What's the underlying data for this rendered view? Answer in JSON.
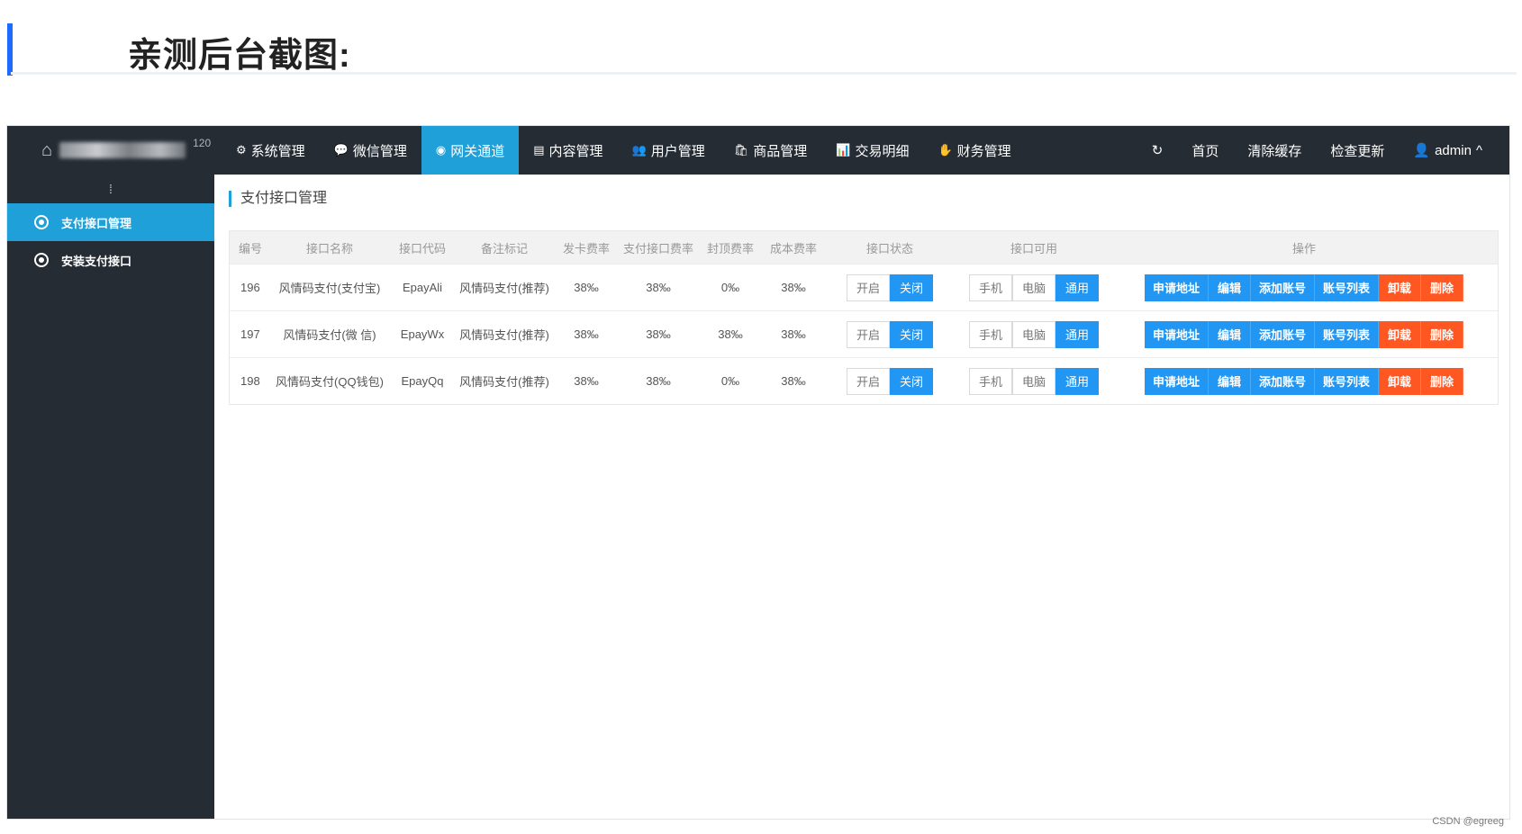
{
  "slide": {
    "title": "亲测后台截图:"
  },
  "topbar": {
    "brand_suffix": "120",
    "nav": [
      {
        "label": "系统管理",
        "icon": "gear-icon",
        "glyph": "⚙"
      },
      {
        "label": "微信管理",
        "icon": "wechat-icon",
        "glyph": "💬"
      },
      {
        "label": "网关通道",
        "icon": "gateway-icon",
        "glyph": "◉"
      },
      {
        "label": "内容管理",
        "icon": "document-icon",
        "glyph": "▤"
      },
      {
        "label": "用户管理",
        "icon": "users-icon",
        "glyph": "👥"
      },
      {
        "label": "商品管理",
        "icon": "shopping-bag-icon",
        "glyph": "🛍"
      },
      {
        "label": "交易明细",
        "icon": "chart-icon",
        "glyph": "📊"
      },
      {
        "label": "财务管理",
        "icon": "finance-icon",
        "glyph": "✋"
      }
    ],
    "refresh_glyph": "↻",
    "home": "首页",
    "clear_cache": "清除缓存",
    "check_update": "检查更新",
    "user": "admin",
    "user_glyph": "👤",
    "caret_glyph": "^"
  },
  "sidebar": {
    "toggle_glyph": "⁞",
    "items": [
      {
        "label": "支付接口管理"
      },
      {
        "label": "安装支付接口"
      }
    ]
  },
  "content": {
    "breadcrumb": "支付接口管理",
    "columns": [
      "编号",
      "接口名称",
      "接口代码",
      "备注标记",
      "发卡费率",
      "支付接口费率",
      "封顶费率",
      "成本费率",
      "接口状态",
      "接口可用",
      "操作"
    ],
    "status_labels": {
      "open": "开启",
      "close": "关闭"
    },
    "avail_labels": {
      "mobile": "手机",
      "pc": "电脑",
      "common": "通用"
    },
    "op_labels": {
      "apply_url": "申请地址",
      "edit": "编辑",
      "add_account": "添加账号",
      "account_list": "账号列表",
      "uninstall": "卸载",
      "delete": "删除"
    },
    "rows": [
      {
        "id": "196",
        "name": "风情码支付(支付宝)",
        "code": "EpayAli",
        "remark": "风情码支付(推荐)",
        "card_rate": "38‰",
        "pay_rate": "38‰",
        "cap_rate": "0‰",
        "cost_rate": "38‰"
      },
      {
        "id": "197",
        "name": "风情码支付(微 信)",
        "code": "EpayWx",
        "remark": "风情码支付(推荐)",
        "card_rate": "38‰",
        "pay_rate": "38‰",
        "cap_rate": "38‰",
        "cost_rate": "38‰"
      },
      {
        "id": "198",
        "name": "风情码支付(QQ钱包)",
        "code": "EpayQq",
        "remark": "风情码支付(推荐)",
        "card_rate": "38‰",
        "pay_rate": "38‰",
        "cap_rate": "0‰",
        "cost_rate": "38‰"
      }
    ]
  },
  "watermark": "CSDN @egreeg"
}
